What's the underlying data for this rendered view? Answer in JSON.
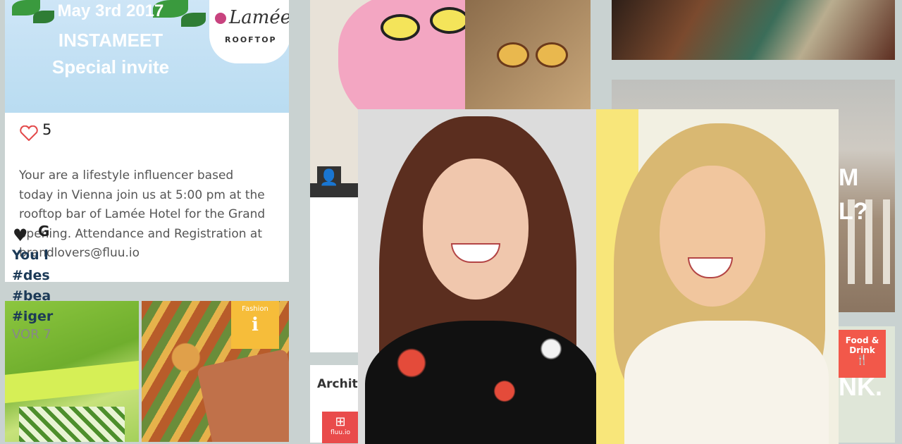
{
  "invite_card": {
    "date_line": "May 3rd 2017",
    "event_line": "INSTAMEET",
    "invite_line": "Special invite",
    "logo_text": "Lamée",
    "logo_sub": "ROOFTOP",
    "likes_count": "5",
    "description": "Your are a lifestyle influencer based today in Vienna join us at 5:00 pm at the rooftop bar of Lamée Hotel for the Grand opening. Attendance and Registration at brandlovers@fluu.io"
  },
  "fashion_badge": {
    "label": "Fashion",
    "icon": "info-icon"
  },
  "post_card": {
    "author_initial": "G",
    "text_lines": [
      "You l",
      "#des",
      "#bea",
      "#iger"
    ],
    "time": "VOR 7"
  },
  "category_card": {
    "label": "Archite",
    "badge": "fluu.io"
  },
  "building_card": {
    "text_top": "M",
    "text_bottom": "L?"
  },
  "food_badge": {
    "label": "Food & Drink",
    "icon": "cutlery-icon"
  },
  "food_card": {
    "text": "NK."
  },
  "colors": {
    "background": "#c9d2d1",
    "heart_outline": "#e3494a",
    "hashtag": "#1c3a57",
    "fashion_badge": "#f6bd3a",
    "food_badge": "#f2584a"
  }
}
